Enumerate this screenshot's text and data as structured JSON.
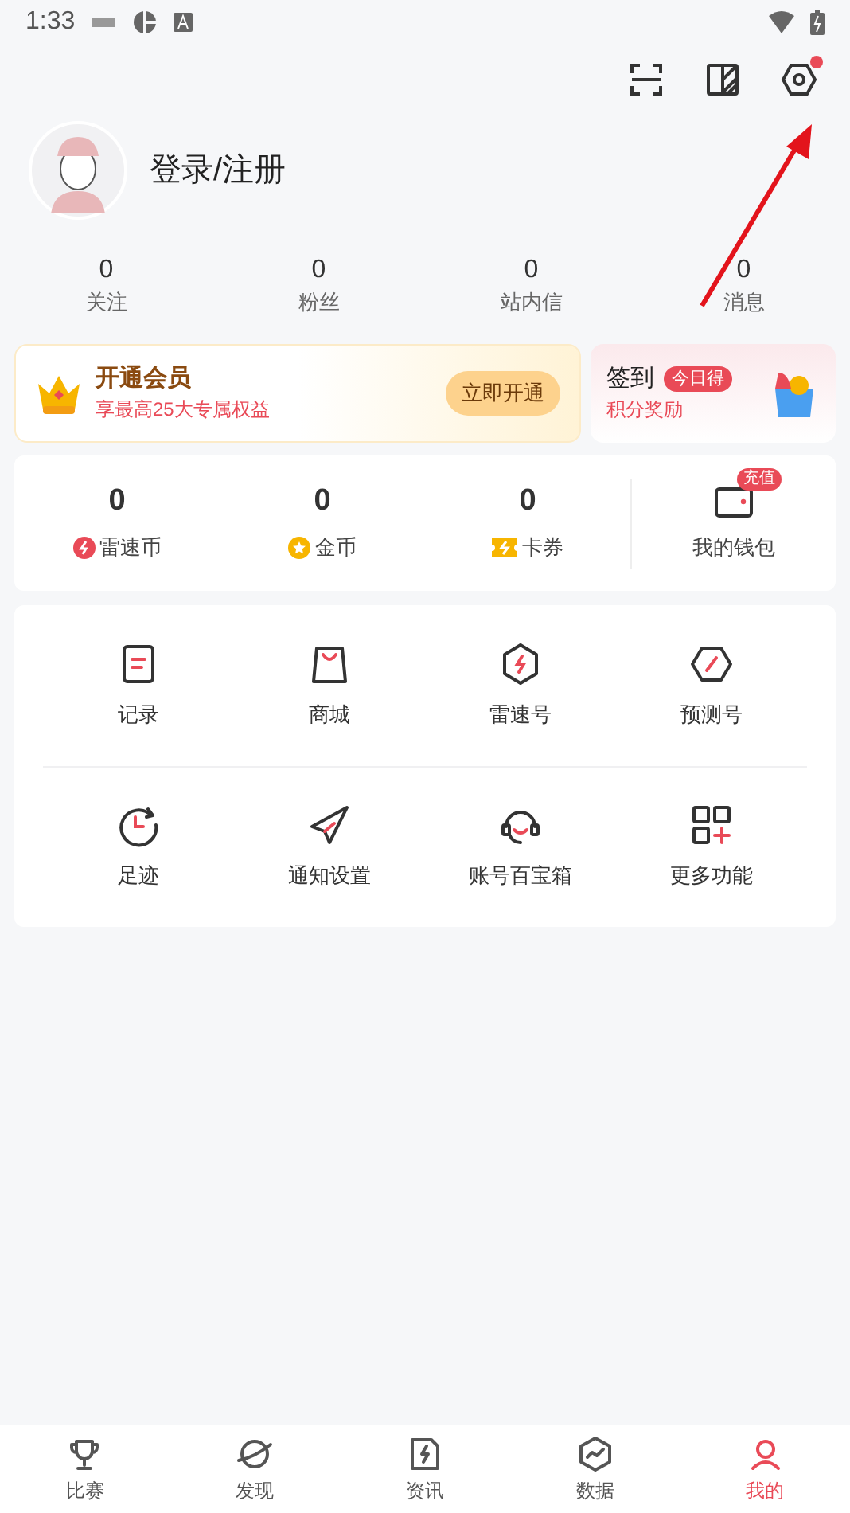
{
  "status_bar": {
    "time": "1:33"
  },
  "toolbar": {
    "settings_has_notification": true
  },
  "profile": {
    "login_label": "登录/注册"
  },
  "stats": [
    {
      "value": "0",
      "label": "关注"
    },
    {
      "value": "0",
      "label": "粉丝"
    },
    {
      "value": "0",
      "label": "站内信"
    },
    {
      "value": "0",
      "label": "消息"
    }
  ],
  "vip_card": {
    "title": "开通会员",
    "subtitle": "享最高25大专属权益",
    "button": "立即开通"
  },
  "checkin_card": {
    "title": "签到",
    "badge": "今日得",
    "subtitle": "积分奖励"
  },
  "wallet": {
    "balances": [
      {
        "value": "0",
        "label": "雷速币",
        "kind": "bolt"
      },
      {
        "value": "0",
        "label": "金币",
        "kind": "coin"
      },
      {
        "value": "0",
        "label": "卡券",
        "kind": "ticket"
      }
    ],
    "label": "我的钱包",
    "badge": "充值"
  },
  "tools": [
    [
      {
        "label": "记录",
        "kind": "note"
      },
      {
        "label": "商城",
        "kind": "bag"
      },
      {
        "label": "雷速号",
        "kind": "hexbolt"
      },
      {
        "label": "预测号",
        "kind": "compass"
      }
    ],
    [
      {
        "label": "足迹",
        "kind": "clock"
      },
      {
        "label": "通知设置",
        "kind": "plane"
      },
      {
        "label": "账号百宝箱",
        "kind": "headset"
      },
      {
        "label": "更多功能",
        "kind": "grid"
      }
    ]
  ],
  "bottom_nav": [
    {
      "label": "比赛",
      "kind": "trophy",
      "selected": false
    },
    {
      "label": "发现",
      "kind": "planet",
      "selected": false
    },
    {
      "label": "资讯",
      "kind": "news",
      "selected": false
    },
    {
      "label": "数据",
      "kind": "chart",
      "selected": false
    },
    {
      "label": "我的",
      "kind": "person",
      "selected": true
    }
  ]
}
